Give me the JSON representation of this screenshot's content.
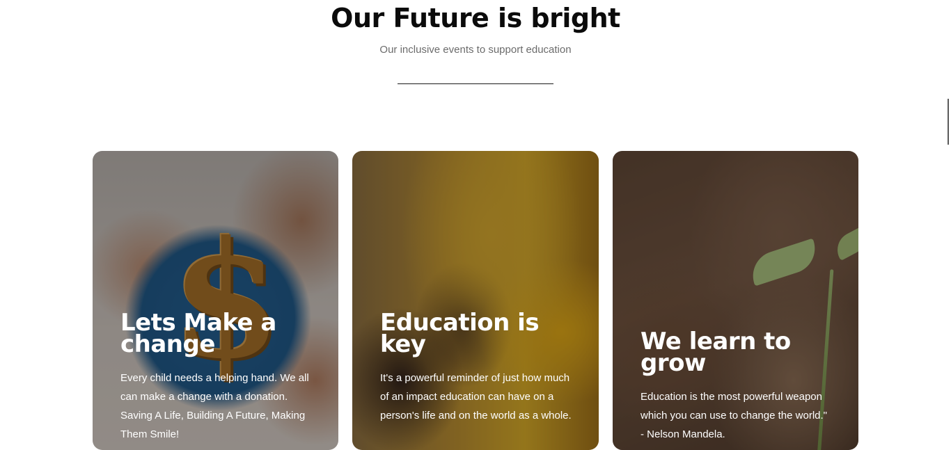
{
  "header": {
    "title": "Our Future is bright",
    "subtitle": "Our inclusive events to support education"
  },
  "cards": [
    {
      "title": "Lets Make a change",
      "text": "Every child needs a helping hand. We all can make a change with a donation. Saving A Life, Building A Future, Making Them Smile!"
    },
    {
      "title": "Education is key",
      "text": "It's a powerful reminder of just how much of an impact education can have on a person's life and on the world as a whole."
    },
    {
      "title": "We learn to grow",
      "text": "Education is the most powerful weapon which you can use to change the world.\" - Nelson Mandela."
    }
  ],
  "colors": {
    "title": "#0b0b0b",
    "subtitle": "#6b6b6b",
    "card_text": "#ffffff"
  }
}
